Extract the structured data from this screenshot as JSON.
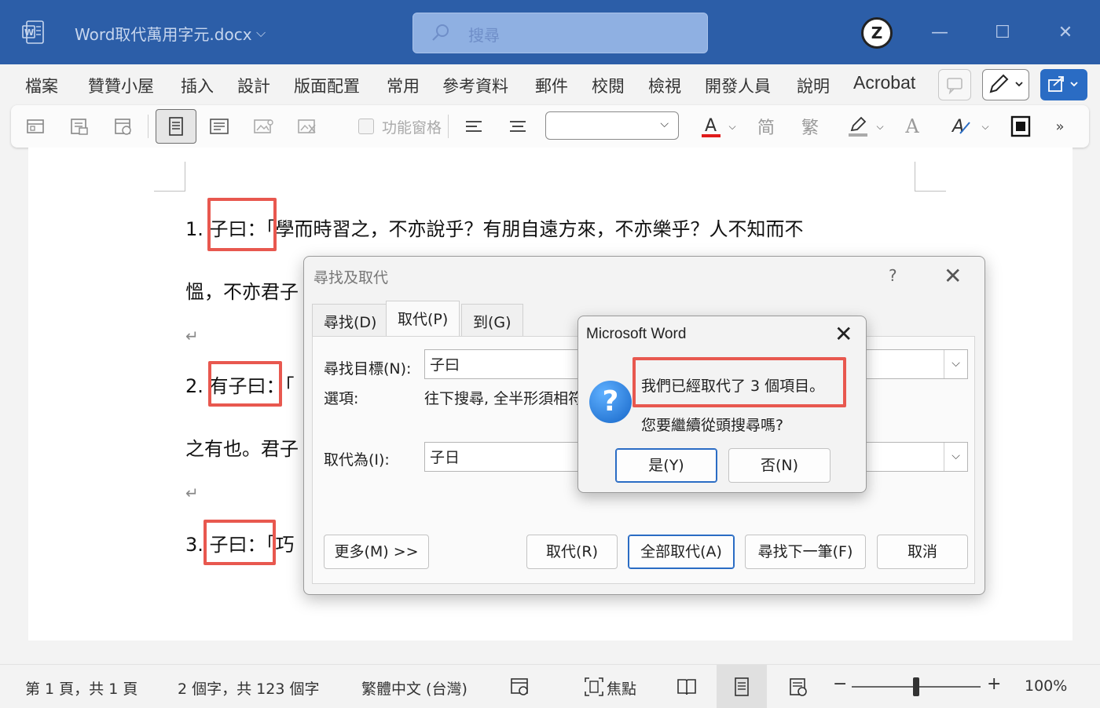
{
  "window": {
    "title": "Word取代萬用字元.docx",
    "search_placeholder": "搜尋",
    "avatar_label": "Z"
  },
  "menu": {
    "items": [
      "檔案",
      "贊贊小屋",
      "插入",
      "設計",
      "版面配置",
      "常用",
      "參考資料",
      "郵件",
      "校閱",
      "檢視",
      "開發人員",
      "說明",
      "Acrobat"
    ]
  },
  "toolbar": {
    "nav_pane_label": "功能窗格",
    "font_name": ""
  },
  "document": {
    "paragraphs": [
      {
        "number": "1.",
        "keyword": "子曰",
        "rest": "：「學而時習之，不亦說乎？有朋自遠方來，不亦樂乎？人不知而不"
      },
      {
        "continuation": "慍，不亦君子"
      },
      {
        "number": "2.",
        "keyword": "有子曰",
        "rest": "：「"
      },
      {
        "continuation": "之有也。君子"
      },
      {
        "number": "3.",
        "keyword": "子曰",
        "rest": "：「巧"
      }
    ]
  },
  "find_replace": {
    "title": "尋找及取代",
    "help": "?",
    "tabs": [
      "尋找(D)",
      "取代(P)",
      "到(G)"
    ],
    "active_tab": 1,
    "find_label": "尋找目標(N):",
    "find_value": "子曰",
    "options_label": "選項:",
    "options_value": "往下搜尋, 全半形須相符",
    "replace_label": "取代為(I):",
    "replace_value": "子日",
    "buttons": {
      "more": "更多(M) >>",
      "replace": "取代(R)",
      "replace_all": "全部取代(A)",
      "find_next": "尋找下一筆(F)",
      "cancel": "取消"
    }
  },
  "message_box": {
    "title": "Microsoft Word",
    "message": "我們已經取代了 3 個項目。",
    "question": "您要繼續從頭搜尋嗎?",
    "yes": "是(Y)",
    "no": "否(N)"
  },
  "status": {
    "page": "第 1 頁，共 1 頁",
    "words": "2 個字，共 123 個字",
    "language": "繁體中文 (台灣)",
    "focus": "焦點",
    "zoom": "100%",
    "zoom_value": 100
  },
  "colors": {
    "titlebar": "#2c5ea8",
    "highlight": "#e8584f",
    "accent": "#2a6cc4"
  }
}
